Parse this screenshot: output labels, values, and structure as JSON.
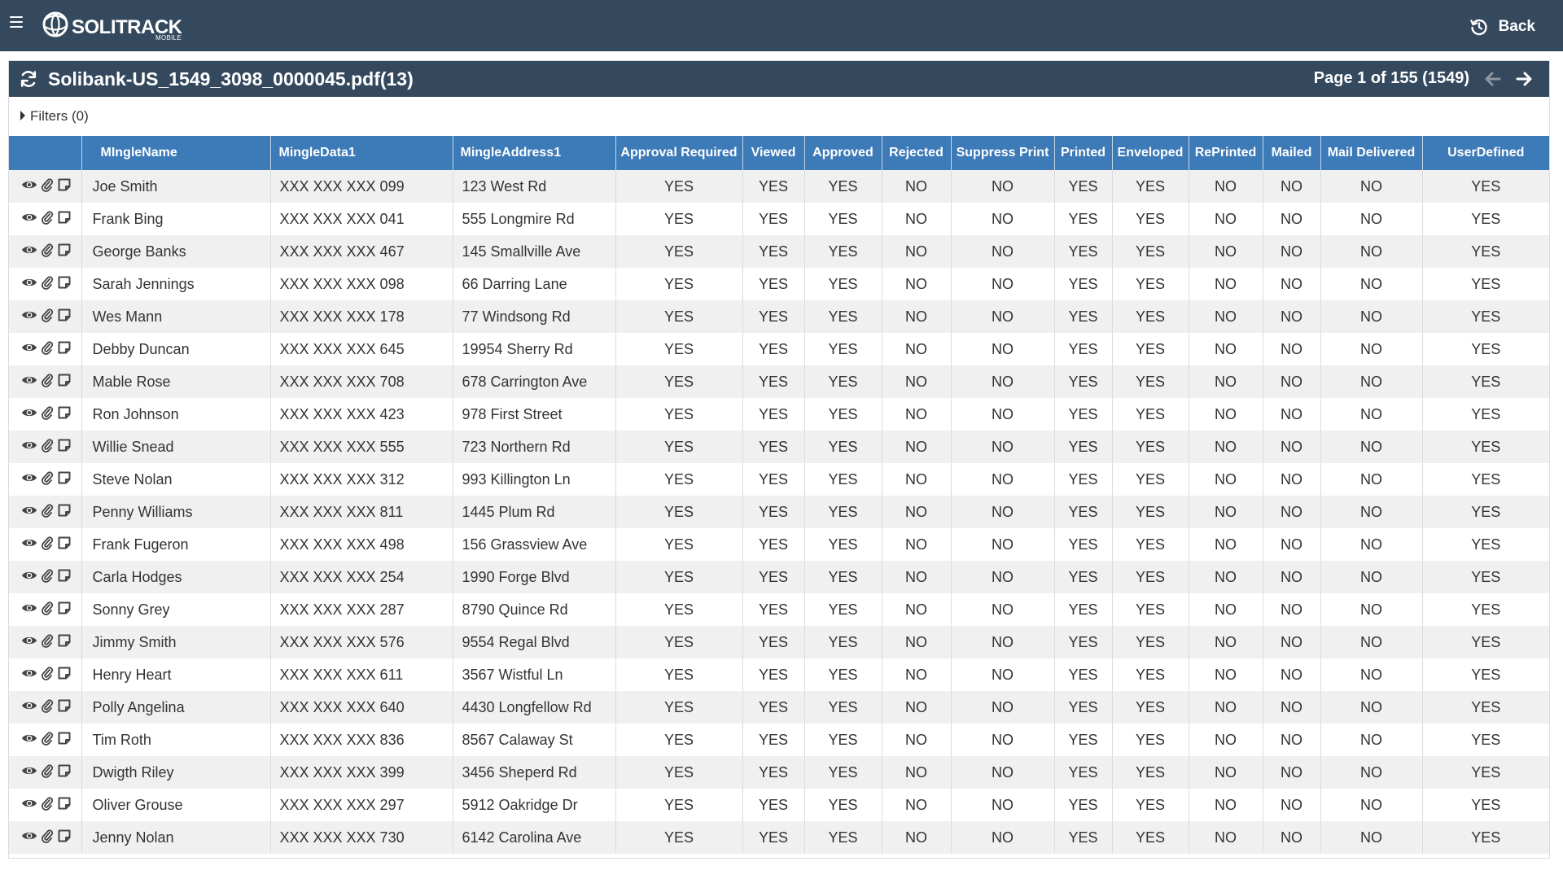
{
  "app": {
    "brand": "SOLITRACK",
    "brand_sub": "MOBILE",
    "back_label": "Back"
  },
  "document": {
    "title": "Solibank-US_1549_3098_0000045.pdf(13)",
    "page_info": "Page 1 of 155 (1549)"
  },
  "filters": {
    "label": "Filters (0)"
  },
  "table": {
    "columns": [
      "",
      "MIngleName",
      "MingleData1",
      "MingleAddress1",
      "Approval Required",
      "Viewed",
      "Approved",
      "Rejected",
      "Suppress Print",
      "Printed",
      "Enveloped",
      "RePrinted",
      "Mailed",
      "Mail Delivered",
      "UserDefined"
    ],
    "rows": [
      [
        "Joe Smith",
        "XXX XXX XXX 099",
        "123 West Rd",
        "YES",
        "YES",
        "YES",
        "NO",
        "NO",
        "YES",
        "YES",
        "NO",
        "NO",
        "NO",
        "YES"
      ],
      [
        "Frank Bing",
        "XXX XXX XXX 041",
        "555 Longmire Rd",
        "YES",
        "YES",
        "YES",
        "NO",
        "NO",
        "YES",
        "YES",
        "NO",
        "NO",
        "NO",
        "YES"
      ],
      [
        "George Banks",
        "XXX XXX XXX 467",
        "145 Smallville Ave",
        "YES",
        "YES",
        "YES",
        "NO",
        "NO",
        "YES",
        "YES",
        "NO",
        "NO",
        "NO",
        "YES"
      ],
      [
        "Sarah Jennings",
        "XXX XXX XXX 098",
        "66 Darring Lane",
        "YES",
        "YES",
        "YES",
        "NO",
        "NO",
        "YES",
        "YES",
        "NO",
        "NO",
        "NO",
        "YES"
      ],
      [
        "Wes Mann",
        "XXX XXX XXX 178",
        "77 Windsong Rd",
        "YES",
        "YES",
        "YES",
        "NO",
        "NO",
        "YES",
        "YES",
        "NO",
        "NO",
        "NO",
        "YES"
      ],
      [
        "Debby Duncan",
        "XXX XXX XXX 645",
        "19954 Sherry Rd",
        "YES",
        "YES",
        "YES",
        "NO",
        "NO",
        "YES",
        "YES",
        "NO",
        "NO",
        "NO",
        "YES"
      ],
      [
        "Mable Rose",
        "XXX XXX XXX 708",
        "678 Carrington Ave",
        "YES",
        "YES",
        "YES",
        "NO",
        "NO",
        "YES",
        "YES",
        "NO",
        "NO",
        "NO",
        "YES"
      ],
      [
        "Ron Johnson",
        "XXX XXX XXX 423",
        "978 First Street",
        "YES",
        "YES",
        "YES",
        "NO",
        "NO",
        "YES",
        "YES",
        "NO",
        "NO",
        "NO",
        "YES"
      ],
      [
        "Willie Snead",
        "XXX XXX XXX 555",
        "723 Northern Rd",
        "YES",
        "YES",
        "YES",
        "NO",
        "NO",
        "YES",
        "YES",
        "NO",
        "NO",
        "NO",
        "YES"
      ],
      [
        "Steve Nolan",
        "XXX XXX XXX 312",
        "993 Killington Ln",
        "YES",
        "YES",
        "YES",
        "NO",
        "NO",
        "YES",
        "YES",
        "NO",
        "NO",
        "NO",
        "YES"
      ],
      [
        "Penny Williams",
        "XXX XXX XXX 811",
        "1445 Plum Rd",
        "YES",
        "YES",
        "YES",
        "NO",
        "NO",
        "YES",
        "YES",
        "NO",
        "NO",
        "NO",
        "YES"
      ],
      [
        "Frank Fugeron",
        "XXX XXX XXX 498",
        "156 Grassview Ave",
        "YES",
        "YES",
        "YES",
        "NO",
        "NO",
        "YES",
        "YES",
        "NO",
        "NO",
        "NO",
        "YES"
      ],
      [
        "Carla Hodges",
        "XXX XXX XXX 254",
        "1990 Forge Blvd",
        "YES",
        "YES",
        "YES",
        "NO",
        "NO",
        "YES",
        "YES",
        "NO",
        "NO",
        "NO",
        "YES"
      ],
      [
        "Sonny Grey",
        "XXX XXX XXX 287",
        "8790 Quince Rd",
        "YES",
        "YES",
        "YES",
        "NO",
        "NO",
        "YES",
        "YES",
        "NO",
        "NO",
        "NO",
        "YES"
      ],
      [
        "Jimmy Smith",
        "XXX XXX XXX 576",
        "9554 Regal Blvd",
        "YES",
        "YES",
        "YES",
        "NO",
        "NO",
        "YES",
        "YES",
        "NO",
        "NO",
        "NO",
        "YES"
      ],
      [
        "Henry Heart",
        "XXX XXX XXX 611",
        "3567 Wistful Ln",
        "YES",
        "YES",
        "YES",
        "NO",
        "NO",
        "YES",
        "YES",
        "NO",
        "NO",
        "NO",
        "YES"
      ],
      [
        "Polly Angelina",
        "XXX XXX XXX 640",
        "4430 Longfellow Rd",
        "YES",
        "YES",
        "YES",
        "NO",
        "NO",
        "YES",
        "YES",
        "NO",
        "NO",
        "NO",
        "YES"
      ],
      [
        "Tim Roth",
        "XXX XXX XXX 836",
        "8567 Calaway St",
        "YES",
        "YES",
        "YES",
        "NO",
        "NO",
        "YES",
        "YES",
        "NO",
        "NO",
        "NO",
        "YES"
      ],
      [
        "Dwigth Riley",
        "XXX XXX XXX 399",
        "3456 Sheperd Rd",
        "YES",
        "YES",
        "YES",
        "NO",
        "NO",
        "YES",
        "YES",
        "NO",
        "NO",
        "NO",
        "YES"
      ],
      [
        "Oliver Grouse",
        "XXX XXX XXX 297",
        "5912 Oakridge Dr",
        "YES",
        "YES",
        "YES",
        "NO",
        "NO",
        "YES",
        "YES",
        "NO",
        "NO",
        "NO",
        "YES"
      ],
      [
        "Jenny Nolan",
        "XXX XXX XXX 730",
        "6142 Carolina Ave",
        "YES",
        "YES",
        "YES",
        "NO",
        "NO",
        "YES",
        "YES",
        "NO",
        "NO",
        "NO",
        "YES"
      ]
    ],
    "row_actions": [
      "eye-icon",
      "paperclip-icon",
      "note-icon"
    ]
  },
  "colors": {
    "header_bg": "#34495e",
    "table_header_bg": "#3d7ab8",
    "row_alt_bg": "#f0f0f0"
  }
}
